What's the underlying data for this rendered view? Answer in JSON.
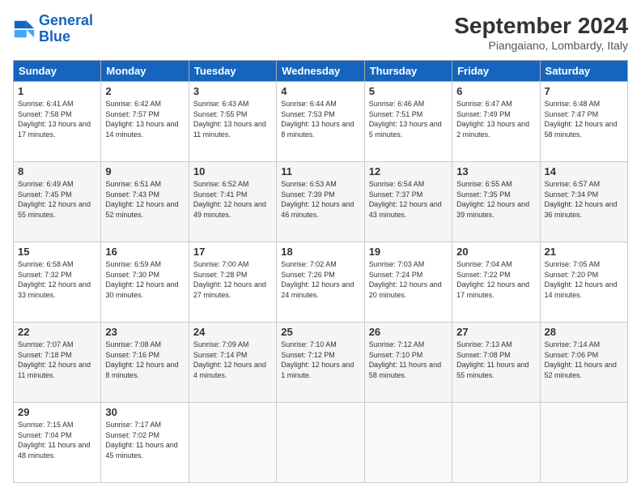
{
  "logo": {
    "line1": "General",
    "line2": "Blue"
  },
  "title": "September 2024",
  "location": "Piangaiano, Lombardy, Italy",
  "headers": [
    "Sunday",
    "Monday",
    "Tuesday",
    "Wednesday",
    "Thursday",
    "Friday",
    "Saturday"
  ],
  "weeks": [
    [
      {
        "day": "1",
        "sunrise": "6:41 AM",
        "sunset": "7:58 PM",
        "daylight": "13 hours and 17 minutes."
      },
      {
        "day": "2",
        "sunrise": "6:42 AM",
        "sunset": "7:57 PM",
        "daylight": "13 hours and 14 minutes."
      },
      {
        "day": "3",
        "sunrise": "6:43 AM",
        "sunset": "7:55 PM",
        "daylight": "13 hours and 11 minutes."
      },
      {
        "day": "4",
        "sunrise": "6:44 AM",
        "sunset": "7:53 PM",
        "daylight": "13 hours and 8 minutes."
      },
      {
        "day": "5",
        "sunrise": "6:46 AM",
        "sunset": "7:51 PM",
        "daylight": "13 hours and 5 minutes."
      },
      {
        "day": "6",
        "sunrise": "6:47 AM",
        "sunset": "7:49 PM",
        "daylight": "13 hours and 2 minutes."
      },
      {
        "day": "7",
        "sunrise": "6:48 AM",
        "sunset": "7:47 PM",
        "daylight": "12 hours and 58 minutes."
      }
    ],
    [
      {
        "day": "8",
        "sunrise": "6:49 AM",
        "sunset": "7:45 PM",
        "daylight": "12 hours and 55 minutes."
      },
      {
        "day": "9",
        "sunrise": "6:51 AM",
        "sunset": "7:43 PM",
        "daylight": "12 hours and 52 minutes."
      },
      {
        "day": "10",
        "sunrise": "6:52 AM",
        "sunset": "7:41 PM",
        "daylight": "12 hours and 49 minutes."
      },
      {
        "day": "11",
        "sunrise": "6:53 AM",
        "sunset": "7:39 PM",
        "daylight": "12 hours and 46 minutes."
      },
      {
        "day": "12",
        "sunrise": "6:54 AM",
        "sunset": "7:37 PM",
        "daylight": "12 hours and 43 minutes."
      },
      {
        "day": "13",
        "sunrise": "6:55 AM",
        "sunset": "7:35 PM",
        "daylight": "12 hours and 39 minutes."
      },
      {
        "day": "14",
        "sunrise": "6:57 AM",
        "sunset": "7:34 PM",
        "daylight": "12 hours and 36 minutes."
      }
    ],
    [
      {
        "day": "15",
        "sunrise": "6:58 AM",
        "sunset": "7:32 PM",
        "daylight": "12 hours and 33 minutes."
      },
      {
        "day": "16",
        "sunrise": "6:59 AM",
        "sunset": "7:30 PM",
        "daylight": "12 hours and 30 minutes."
      },
      {
        "day": "17",
        "sunrise": "7:00 AM",
        "sunset": "7:28 PM",
        "daylight": "12 hours and 27 minutes."
      },
      {
        "day": "18",
        "sunrise": "7:02 AM",
        "sunset": "7:26 PM",
        "daylight": "12 hours and 24 minutes."
      },
      {
        "day": "19",
        "sunrise": "7:03 AM",
        "sunset": "7:24 PM",
        "daylight": "12 hours and 20 minutes."
      },
      {
        "day": "20",
        "sunrise": "7:04 AM",
        "sunset": "7:22 PM",
        "daylight": "12 hours and 17 minutes."
      },
      {
        "day": "21",
        "sunrise": "7:05 AM",
        "sunset": "7:20 PM",
        "daylight": "12 hours and 14 minutes."
      }
    ],
    [
      {
        "day": "22",
        "sunrise": "7:07 AM",
        "sunset": "7:18 PM",
        "daylight": "12 hours and 11 minutes."
      },
      {
        "day": "23",
        "sunrise": "7:08 AM",
        "sunset": "7:16 PM",
        "daylight": "12 hours and 8 minutes."
      },
      {
        "day": "24",
        "sunrise": "7:09 AM",
        "sunset": "7:14 PM",
        "daylight": "12 hours and 4 minutes."
      },
      {
        "day": "25",
        "sunrise": "7:10 AM",
        "sunset": "7:12 PM",
        "daylight": "12 hours and 1 minute."
      },
      {
        "day": "26",
        "sunrise": "7:12 AM",
        "sunset": "7:10 PM",
        "daylight": "11 hours and 58 minutes."
      },
      {
        "day": "27",
        "sunrise": "7:13 AM",
        "sunset": "7:08 PM",
        "daylight": "11 hours and 55 minutes."
      },
      {
        "day": "28",
        "sunrise": "7:14 AM",
        "sunset": "7:06 PM",
        "daylight": "11 hours and 52 minutes."
      }
    ],
    [
      {
        "day": "29",
        "sunrise": "7:15 AM",
        "sunset": "7:04 PM",
        "daylight": "11 hours and 48 minutes."
      },
      {
        "day": "30",
        "sunrise": "7:17 AM",
        "sunset": "7:02 PM",
        "daylight": "11 hours and 45 minutes."
      },
      null,
      null,
      null,
      null,
      null
    ]
  ]
}
